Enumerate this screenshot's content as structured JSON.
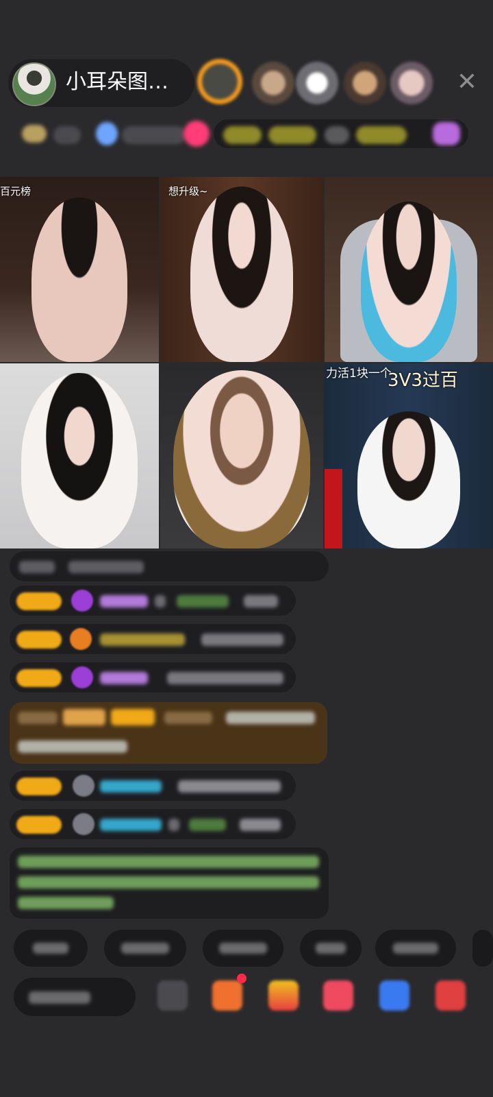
{
  "header": {
    "host_name": "小耳朵图…",
    "close_glyph": "✕"
  },
  "tiles": [
    {
      "label": "百元榜"
    },
    {
      "label": "想升级~"
    },
    {
      "label": ""
    },
    {
      "label": ""
    },
    {
      "label": ""
    },
    {
      "label": "力活1块一个"
    }
  ],
  "tile6_big": "3V3过百",
  "colors": {
    "level_badge": "#f0a917",
    "gem_purple": "#9b3fd6",
    "gem_orange": "#e77e22",
    "system_green": "#7ec86a",
    "name_cyan": "#34a6c9"
  }
}
